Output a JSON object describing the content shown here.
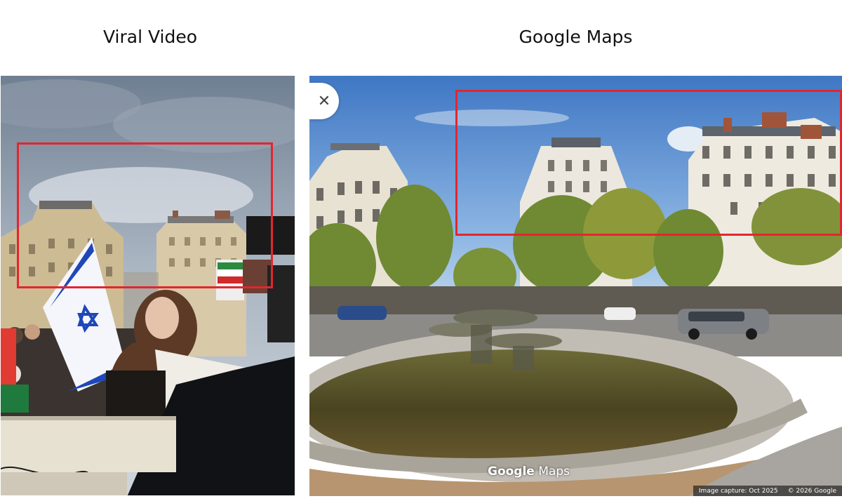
{
  "left_panel": {
    "title": "Viral Video"
  },
  "right_panel": {
    "title": "Google Maps",
    "close_icon": "close-icon",
    "watermark_brand": "Google",
    "watermark_product": "Maps",
    "image_capture": "Image capture: Oct 2025",
    "copyright": "© 2026 Google"
  },
  "colors": {
    "highlight_box": "#e3262d",
    "israel_flag_blue": "#1f47b8"
  }
}
